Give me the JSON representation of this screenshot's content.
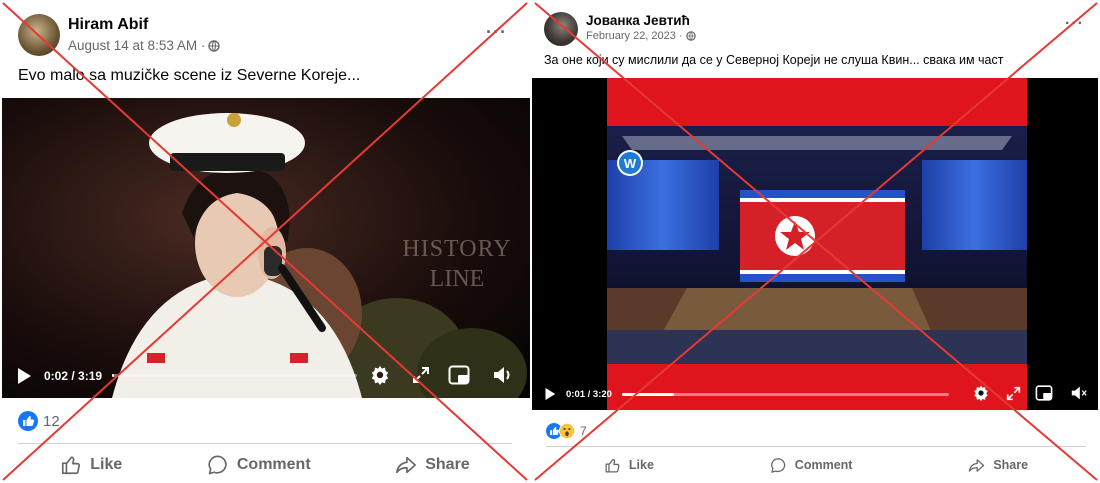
{
  "posts": [
    {
      "author": "Hiram Abif",
      "date": "August 14 at 8:53 AM · ",
      "caption": "Evo malo sa muzičke scene iz Severne Koreje...",
      "video": {
        "time": "0:02 / 3:19",
        "progress": 0.01,
        "watermark": [
          "HISTORY",
          "LINE"
        ]
      },
      "reaction_count": "12",
      "actions": {
        "like": "Like",
        "comment": "Comment",
        "share": "Share"
      }
    },
    {
      "author": "Јованка Јевтић",
      "date": "February 22, 2023 · ",
      "caption": "За оне који су мислили да се у Северној Кореји не слуша Квин... свака им част",
      "video": {
        "time": "0:01 / 3:20",
        "progress": 0.16,
        "channel_logo": "W"
      },
      "reaction_count": "7",
      "actions": {
        "like": "Like",
        "comment": "Comment",
        "share": "Share"
      }
    }
  ],
  "colors": {
    "cross": "#e53935",
    "like_blue": "#1877f2",
    "red_band": "#e0141d",
    "muted": "#65676b"
  },
  "icons": [
    "globe-icon",
    "more-icon",
    "play-icon",
    "settings-icon",
    "fullscreen-icon",
    "miniplayer-icon",
    "volume-icon",
    "like-reaction-icon",
    "wow-reaction-icon",
    "like-icon",
    "comment-icon",
    "share-icon"
  ]
}
